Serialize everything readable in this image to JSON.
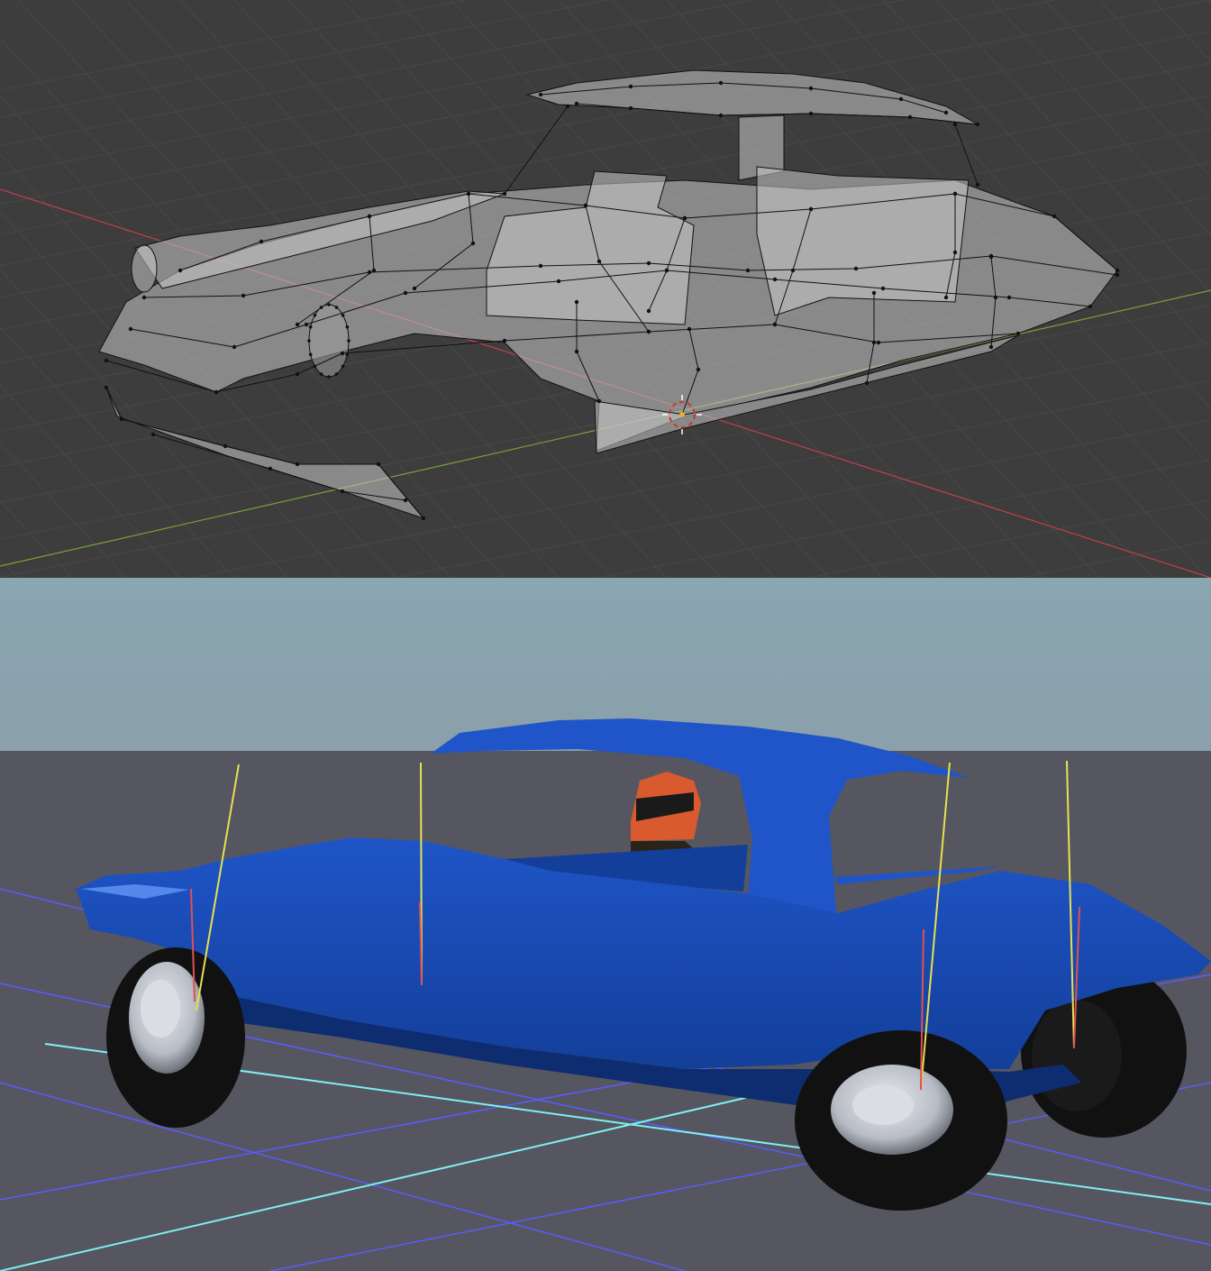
{
  "panels": {
    "top": {
      "kind": "3d-modeling-viewport",
      "shading": "wireframe-xray",
      "colors": {
        "background": "#3d3d3d",
        "grid": "#484848",
        "axis_x": "#c0404a",
        "axis_y": "#7aa03c",
        "mesh_face": "#c8c8c8",
        "mesh_edge": "#111111",
        "cursor_ring": "#ffffff",
        "cursor_dash": "#cc3333",
        "origin": "#f2a830"
      }
    },
    "bottom": {
      "kind": "3d-game-render",
      "colors": {
        "sky_top": "#8aa6b0",
        "sky_bottom": "#8aa0ab",
        "ground": "#555660",
        "grid_blue": "#5a5cff",
        "grid_cyan": "#7ff0f0",
        "car_body": "#1f55c8",
        "car_body_dark": "#133f9a",
        "car_underside": "#0e2d70",
        "tire": "#111111",
        "hub": "#b8bcc4",
        "helmet": "#d85a2e",
        "ray_yellow": "#e8e050",
        "ray_red": "#e05050"
      }
    }
  }
}
